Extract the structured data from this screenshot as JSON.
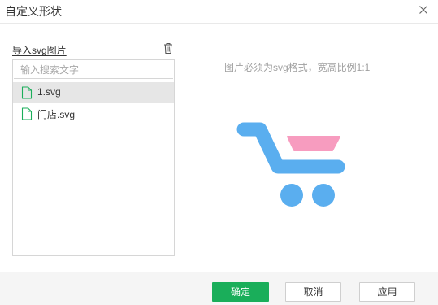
{
  "dialog": {
    "title": "自定义形状"
  },
  "importer": {
    "label": "导入svg图片",
    "search_placeholder": "输入搜索文字",
    "files": [
      {
        "name": "1.svg",
        "selected": true
      },
      {
        "name": "门店.svg",
        "selected": false
      }
    ]
  },
  "preview": {
    "hint": "图片必须为svg格式，宽高比例1:1",
    "icon": "shopping-cart-icon",
    "colors": {
      "cart": "#5aaeef",
      "basket": "#f79cbf"
    }
  },
  "footer": {
    "ok_label": "确定",
    "cancel_label": "取消",
    "apply_label": "应用"
  },
  "colors": {
    "primary": "#1aae5a",
    "file_icon": "#1aae5a",
    "selected_row": "#e6e6e6"
  }
}
